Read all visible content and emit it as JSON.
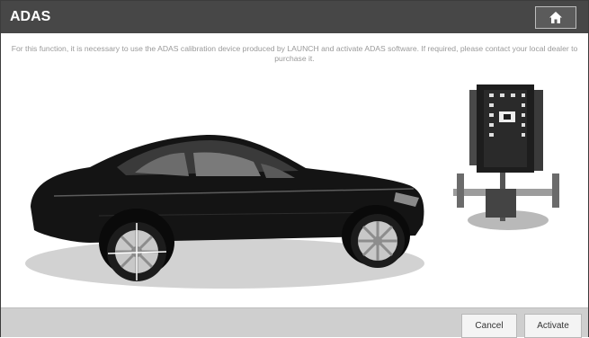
{
  "header": {
    "title": "ADAS",
    "home_icon": "home-icon"
  },
  "notice": "For this function, it is necessary to use the ADAS calibration device produced by LAUNCH and activate ADAS software. If required, please contact your local dealer to purchase it.",
  "footer": {
    "cancel_label": "Cancel",
    "activate_label": "Activate"
  },
  "colors": {
    "header_bg": "#474747",
    "footer_bg": "#cfcfcf",
    "text_muted": "#9a9a9a"
  }
}
